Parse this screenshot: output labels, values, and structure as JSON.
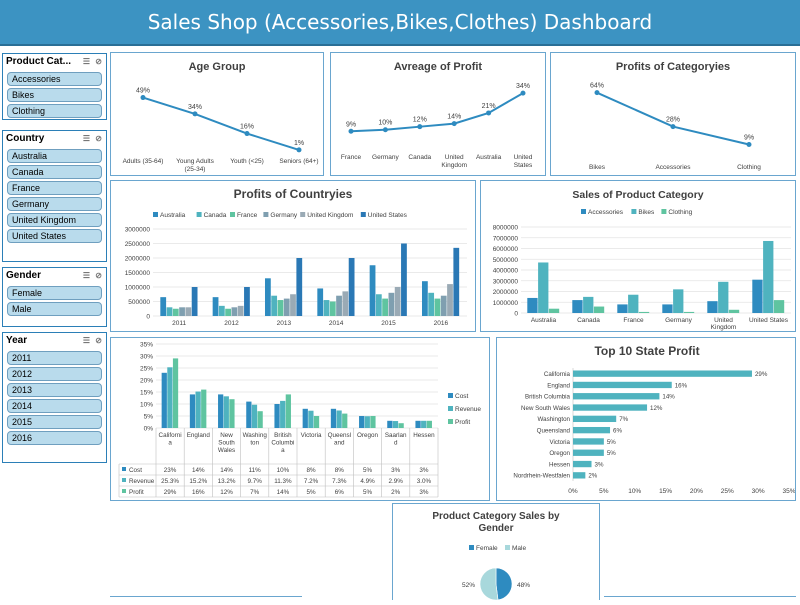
{
  "header": {
    "title": "Sales Shop (Accessories,Bikes,Clothes) Dashboard"
  },
  "colors": {
    "header": "#3c93c2",
    "accent_dark": "#2e8bc0",
    "teal": "#4fb3bf",
    "green": "#5fc4a0",
    "grey": "#8c9da8",
    "slicer_item": "#b9dbec"
  },
  "slicers": {
    "product_category": {
      "title": "Product Cat...",
      "items": [
        "Accessories",
        "Bikes",
        "Clothing"
      ]
    },
    "country": {
      "title": "Country",
      "items": [
        "Australia",
        "Canada",
        "France",
        "Germany",
        "United Kingdom",
        "United States"
      ]
    },
    "gender": {
      "title": "Gender",
      "items": [
        "Female",
        "Male"
      ]
    },
    "year": {
      "title": "Year",
      "items": [
        "2011",
        "2012",
        "2013",
        "2014",
        "2015",
        "2016"
      ]
    },
    "icons": [
      "multi-select-icon",
      "clear-filter-icon"
    ]
  },
  "chart_data": [
    {
      "id": "age_group",
      "type": "line",
      "title": "Age Group",
      "categories": [
        "Adults (35-64)",
        "Young Adults (25-34)",
        "Youth (<25)",
        "Seniors (64+)"
      ],
      "values": [
        49,
        34,
        16,
        1
      ],
      "labels": [
        "49%",
        "34%",
        "16%",
        "1%"
      ],
      "ylim": [
        0,
        55
      ]
    },
    {
      "id": "avg_profit",
      "type": "line",
      "title": "Avreage of Profit",
      "categories": [
        "France",
        "Germany",
        "Canada",
        "United Kingdom",
        "Australia",
        "United States"
      ],
      "values": [
        9,
        10,
        12,
        14,
        21,
        34
      ],
      "labels": [
        "9%",
        "10%",
        "12%",
        "14%",
        "21%",
        "34%"
      ],
      "ylim": [
        0,
        38
      ]
    },
    {
      "id": "profit_categories",
      "type": "line",
      "title": "Profits of Categoryies",
      "categories": [
        "Bikes",
        "Accessories",
        "Clothing"
      ],
      "values": [
        64,
        28,
        9
      ],
      "labels": [
        "64%",
        "28%",
        "9%"
      ],
      "ylim": [
        0,
        70
      ]
    },
    {
      "id": "profit_countries",
      "type": "bar",
      "title": "Profits of Countryies",
      "categories": [
        "2011",
        "2012",
        "2013",
        "2014",
        "2015",
        "2016"
      ],
      "ylim": [
        0,
        3000000
      ],
      "yticks": [
        "0",
        "500000",
        "1000000",
        "1500000",
        "2000000",
        "2500000",
        "3000000"
      ],
      "series": [
        {
          "name": "Australia",
          "color": "#2e8bc0",
          "values": [
            650000,
            650000,
            1300000,
            950000,
            1750000,
            1200000
          ]
        },
        {
          "name": "Canada",
          "color": "#4fb3bf",
          "values": [
            300000,
            350000,
            700000,
            550000,
            750000,
            800000
          ]
        },
        {
          "name": "France",
          "color": "#5fc4a0",
          "values": [
            250000,
            250000,
            550000,
            500000,
            600000,
            600000
          ]
        },
        {
          "name": "Germany",
          "color": "#7f9fb0",
          "values": [
            300000,
            300000,
            600000,
            700000,
            800000,
            700000
          ]
        },
        {
          "name": "United Kingdom",
          "color": "#9aaab5",
          "values": [
            300000,
            350000,
            750000,
            850000,
            1000000,
            1100000
          ]
        },
        {
          "name": "United States",
          "color": "#2a78b5",
          "values": [
            1000000,
            1000000,
            2000000,
            2000000,
            2500000,
            2350000
          ]
        }
      ]
    },
    {
      "id": "sales_product_category",
      "type": "bar",
      "title": "Sales of Product Category",
      "categories": [
        "Australia",
        "Canada",
        "France",
        "Germany",
        "United Kingdom",
        "United States"
      ],
      "ylim": [
        0,
        8000000
      ],
      "yticks": [
        "0",
        "1000000",
        "2000000",
        "3000000",
        "4000000",
        "5000000",
        "6000000",
        "7000000",
        "8000000"
      ],
      "series": [
        {
          "name": "Accessories",
          "color": "#2e8bc0",
          "values": [
            1400000,
            1200000,
            800000,
            800000,
            1100000,
            3100000
          ]
        },
        {
          "name": "Bikes",
          "color": "#4fb3bf",
          "values": [
            4700000,
            1500000,
            1700000,
            2200000,
            2900000,
            6700000
          ]
        },
        {
          "name": "Clothing",
          "color": "#5fc4a0",
          "values": [
            400000,
            600000,
            100000,
            100000,
            300000,
            1200000
          ]
        }
      ]
    },
    {
      "id": "state_cost_rev_profit",
      "type": "bar",
      "title": "",
      "categories": [
        "California",
        "England",
        "New South Wales",
        "Washington",
        "British Columbia",
        "Victoria",
        "Queensland",
        "Oregon",
        "Saarland",
        "Hessen"
      ],
      "ylim": [
        0,
        35
      ],
      "yticks": [
        "0%",
        "5%",
        "10%",
        "15%",
        "20%",
        "25%",
        "30%",
        "35%"
      ],
      "series": [
        {
          "name": "Cost",
          "color": "#2e8bc0",
          "values": [
            23,
            14,
            14,
            11,
            10,
            8,
            8,
            5,
            3,
            3
          ],
          "labels": [
            "23%",
            "14%",
            "14%",
            "11%",
            "10%",
            "8%",
            "8%",
            "5%",
            "3%",
            "3%"
          ]
        },
        {
          "name": "Revenue",
          "color": "#4fb3bf",
          "values": [
            25.3,
            15.2,
            13.2,
            9.7,
            11.3,
            7.2,
            7.3,
            4.9,
            2.9,
            3.0
          ],
          "labels": [
            "25.3%",
            "15.2%",
            "13.2%",
            "9.7%",
            "11.3%",
            "7.2%",
            "7.3%",
            "4.9%",
            "2.9%",
            "3.0%"
          ]
        },
        {
          "name": "Profit",
          "color": "#5fc4a0",
          "values": [
            29,
            16,
            12,
            7,
            14,
            5,
            6,
            5,
            2,
            3
          ],
          "labels": [
            "29%",
            "16%",
            "12%",
            "7%",
            "14%",
            "5%",
            "6%",
            "5%",
            "2%",
            "3%"
          ]
        }
      ]
    },
    {
      "id": "top10_state_profit",
      "type": "bar",
      "title": "Top 10 State Profit",
      "categories": [
        "California",
        "England",
        "British Columbia",
        "New South Wales",
        "Washington",
        "Queensland",
        "Victoria",
        "Oregon",
        "Hessen",
        "Nordrhein-Westfalen"
      ],
      "values": [
        29,
        16,
        14,
        12,
        7,
        6,
        5,
        5,
        3,
        2
      ],
      "labels": [
        "29%",
        "16%",
        "14%",
        "12%",
        "7%",
        "6%",
        "5%",
        "5%",
        "3%",
        "2%"
      ],
      "xlim": [
        0,
        35
      ],
      "xticks": [
        "0%",
        "5%",
        "10%",
        "15%",
        "20%",
        "25%",
        "30%",
        "35%"
      ]
    },
    {
      "id": "gender_sales",
      "type": "pie",
      "title": "Product Category Sales by Gender",
      "series": [
        {
          "name": "Female",
          "color": "#2e8bc0",
          "value": 48,
          "label": "48%"
        },
        {
          "name": "Male",
          "color": "#a8d8dc",
          "value": 52,
          "label": "52%"
        }
      ]
    }
  ]
}
